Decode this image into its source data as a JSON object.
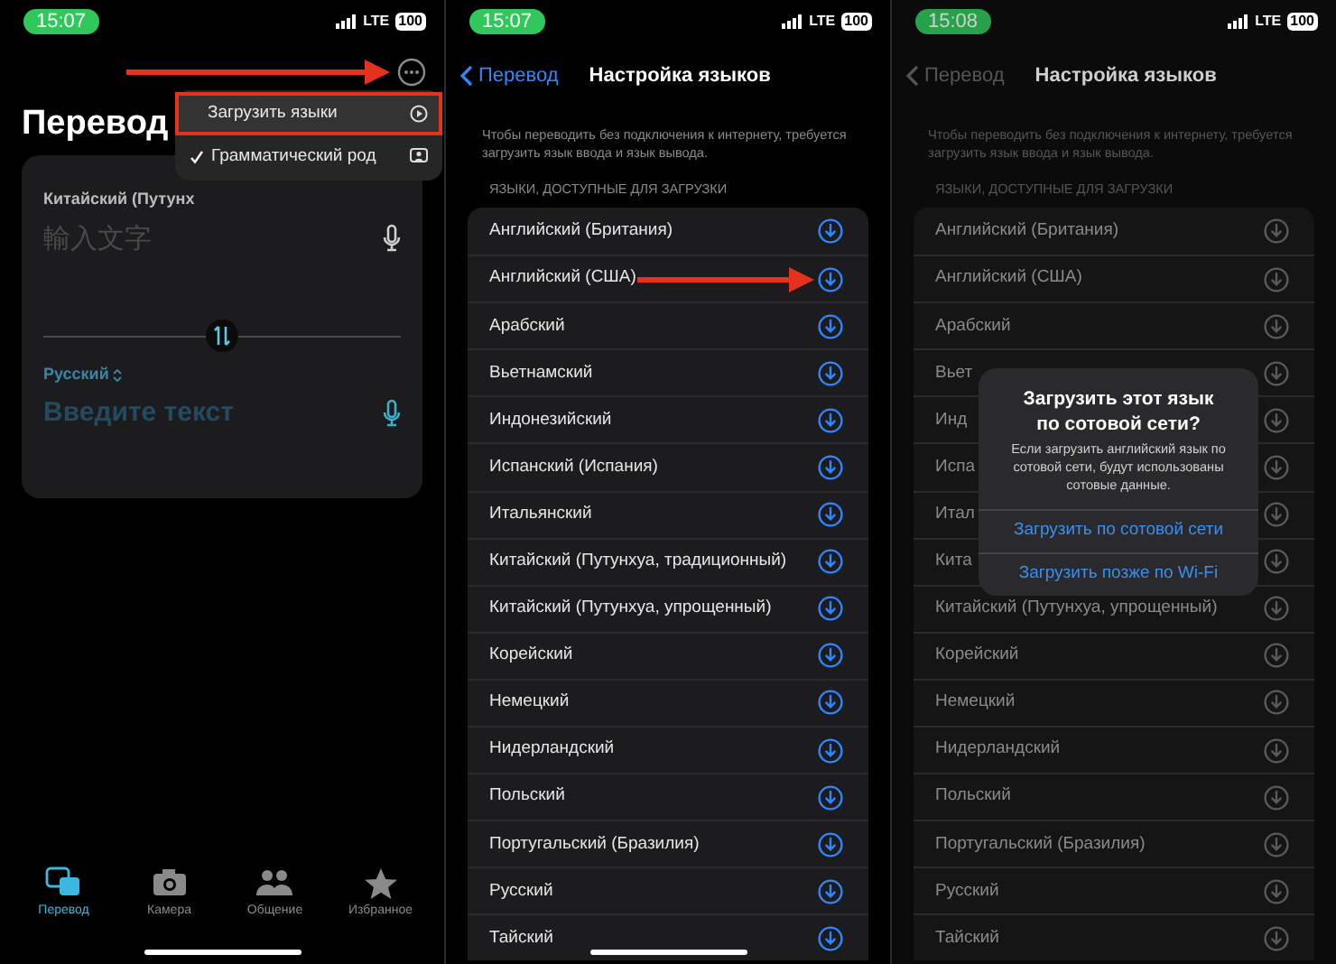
{
  "translate_screen": {
    "status_bar": {
      "time": "15:07",
      "network": "LTE",
      "battery": "100"
    },
    "title": "Перевод",
    "menu_marked": true,
    "menu": [
      {
        "label": "Загрузить языки",
        "checked": false,
        "marked": true
      },
      {
        "label": "Грамматический род",
        "checked": true,
        "marked": false
      }
    ],
    "source": {
      "language": "Китайский (Путунх",
      "placeholder": "輸入文字"
    },
    "target": {
      "language": "Русский",
      "placeholder": "Введите текст"
    },
    "tabs": [
      {
        "label": "Перевод",
        "selected": true
      },
      {
        "label": "Камера",
        "selected": false
      },
      {
        "label": "Общение",
        "selected": false
      },
      {
        "label": "Избранное",
        "selected": false
      }
    ]
  },
  "language_settings_screen": {
    "dimmed": false,
    "status_bar": {
      "time": "15:07",
      "network": "LTE",
      "battery": "100"
    },
    "back": "Перевод",
    "title": "Настройка языков",
    "description": "Чтобы переводить без подключения к интернету, требуется загрузить язык ввода и язык вывода.",
    "section": "ЯЗЫКИ, ДОСТУПНЫЕ ДЛЯ ЗАГРУЗКИ",
    "languages": [
      {
        "name": "Английский (Британия)",
        "marked": false
      },
      {
        "name": "Английский (США)",
        "marked": true
      },
      {
        "name": "Арабский",
        "marked": false
      },
      {
        "name": "Вьетнамский",
        "marked": false
      },
      {
        "name": "Индонезийский",
        "marked": false
      },
      {
        "name": "Испанский (Испания)",
        "marked": false
      },
      {
        "name": "Итальянский",
        "marked": false
      },
      {
        "name": "Китайский (Путунхуа, традиционный)",
        "marked": false
      },
      {
        "name": "Китайский (Путунхуа, упрощенный)",
        "marked": false
      },
      {
        "name": "Корейский",
        "marked": false
      },
      {
        "name": "Немецкий",
        "marked": false
      },
      {
        "name": "Нидерландский",
        "marked": false
      },
      {
        "name": "Польский",
        "marked": false
      },
      {
        "name": "Португальский (Бразилия)",
        "marked": false
      },
      {
        "name": "Русский",
        "marked": false
      },
      {
        "name": "Тайский",
        "marked": false
      }
    ]
  },
  "language_settings_dialog_screen": {
    "dimmed": true,
    "status_bar": {
      "time": "15:08",
      "network": "LTE",
      "battery": "100"
    },
    "back": "Перевод",
    "title": "Настройка языков",
    "description": "Чтобы переводить без подключения к интернету, требуется загрузить язык ввода и язык вывода.",
    "section": "ЯЗЫКИ, ДОСТУПНЫЕ ДЛЯ ЗАГРУЗКИ",
    "languages": [
      {
        "name": "Английский (Британия)",
        "marked": false
      },
      {
        "name": "Английский (США)",
        "marked": false
      },
      {
        "name": "Арабский",
        "marked": false
      },
      {
        "name": "Вьет",
        "marked": false
      },
      {
        "name": "Инд",
        "marked": false
      },
      {
        "name": "Испа",
        "marked": false
      },
      {
        "name": "Итал",
        "marked": false
      },
      {
        "name": "Кита",
        "marked": false
      },
      {
        "name": "Китайский (Путунхуа, упрощенный)",
        "marked": false
      },
      {
        "name": "Корейский",
        "marked": false
      },
      {
        "name": "Немецкий",
        "marked": false
      },
      {
        "name": "Нидерландский",
        "marked": false
      },
      {
        "name": "Польский",
        "marked": false
      },
      {
        "name": "Португальский (Бразилия)",
        "marked": false
      },
      {
        "name": "Русский",
        "marked": false
      },
      {
        "name": "Тайский",
        "marked": false
      }
    ],
    "dialog": {
      "title": "Загрузить этот язык по сотовой сети?",
      "message": "Если загрузить английский язык по сотовой сети, будут использованы сотовые данные.",
      "buttons": [
        "Загрузить по сотовой сети",
        "Загрузить позже по Wi-Fi"
      ]
    }
  }
}
